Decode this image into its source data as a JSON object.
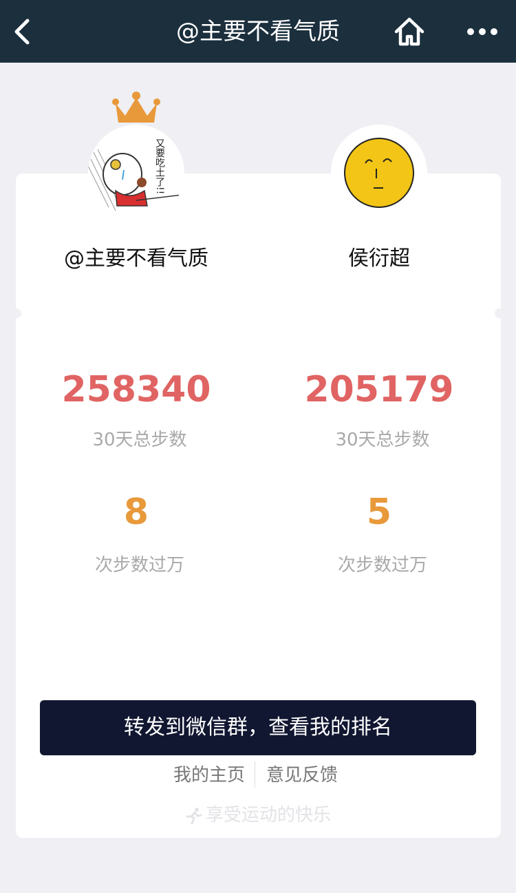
{
  "navbar": {
    "title": "@主要不看气质",
    "back_icon": "chevron-left-icon",
    "home_icon": "home-icon",
    "more_icon": "more-icon"
  },
  "players": [
    {
      "name": "@主要不看气质",
      "total_steps": "258340",
      "total_steps_label": "30天总步数",
      "over_10k": "8",
      "over_10k_label": "次步数过万",
      "winner": true,
      "avatar_text": "又要吃土了!!"
    },
    {
      "name": "侯衍超",
      "total_steps": "205179",
      "total_steps_label": "30天总步数",
      "over_10k": "5",
      "over_10k_label": "次步数过万",
      "winner": false
    }
  ],
  "share_button": "转发到微信群，查看我的排名",
  "links": {
    "home": "我的主页",
    "feedback": "意见反馈"
  },
  "footer": "享受运动的快乐",
  "colors": {
    "navbar": "#1b2f3d",
    "steps": "#e06463",
    "over_10k": "#e8993a",
    "button": "#111731",
    "crown": "#e8993a"
  }
}
